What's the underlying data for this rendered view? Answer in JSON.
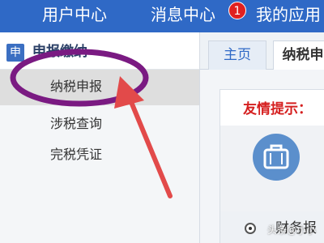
{
  "header": {
    "nav_items": [
      "用户中心",
      "消息中心",
      "我的应用"
    ],
    "message_badge": "1"
  },
  "sidebar": {
    "module_icon": "申",
    "module_title": "申报缴纳",
    "items": [
      {
        "label": "纳税申报",
        "selected": true
      },
      {
        "label": "涉税查询"
      },
      {
        "label": "完税凭证"
      }
    ]
  },
  "main": {
    "tabs": [
      "主页",
      "纳税申"
    ],
    "tip_title": "友情提示：",
    "info_icon": "briefcase-icon",
    "radio_label": "财务报"
  },
  "watermark": "头条@小小",
  "colors": {
    "topbar": "#2f69c6",
    "highlight_circle": "#7a1a82",
    "arrow": "#e24a4a",
    "alert_text": "#d51f1f"
  }
}
